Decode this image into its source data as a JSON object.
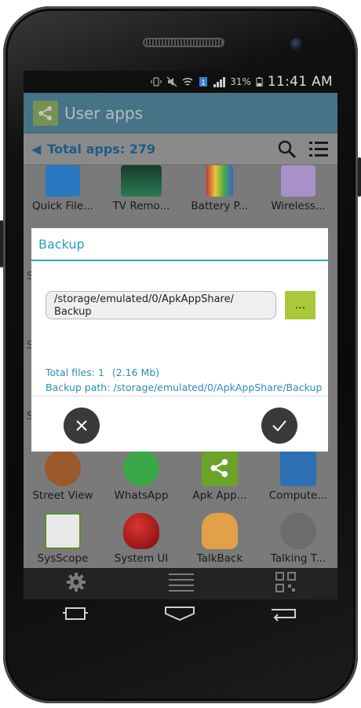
{
  "status": {
    "battery_percent": "31%",
    "time": "11:41 AM"
  },
  "appbar": {
    "title": "User apps"
  },
  "toolbar": {
    "total_label": "Total apps: 279"
  },
  "apps_top": [
    {
      "label": "Quick File...",
      "color": "#2b78c2"
    },
    {
      "label": "TV Remo...",
      "color": "#1a6b4a"
    },
    {
      "label": "Battery P...",
      "color": "#c8b23a"
    },
    {
      "label": "Wireless...",
      "color": "#8a6bb0"
    }
  ],
  "apps_row1": [
    {
      "label": "Street View",
      "color": "#b85f24"
    },
    {
      "label": "WhatsApp",
      "color": "#3aa846"
    },
    {
      "label": "Apk App...",
      "color": "#6aa22a"
    },
    {
      "label": "Compute...",
      "color": "#2f6fb3"
    }
  ],
  "apps_row2": [
    {
      "label": "SysScope",
      "color": "#5a8f2e"
    },
    {
      "label": "System UI",
      "color": "#a81e1e"
    },
    {
      "label": "TalkBack",
      "color": "#d98a1e"
    },
    {
      "label": "Talking T...",
      "color": "#6c6c6c"
    }
  ],
  "dialog": {
    "title": "Backup",
    "path_value": "/storage/emulated/0/ApkAppShare/\nBackup",
    "browse_label": "...",
    "total_files_label": "Total files: 1",
    "total_size": "(2.16 Mb)",
    "backup_path_label": "Backup path: /storage/emulated/0/ApkAppShare/Backup"
  },
  "colors": {
    "accent": "#2aa6d2",
    "browse": "#a9c93a",
    "appbar": "#1f6e93"
  }
}
